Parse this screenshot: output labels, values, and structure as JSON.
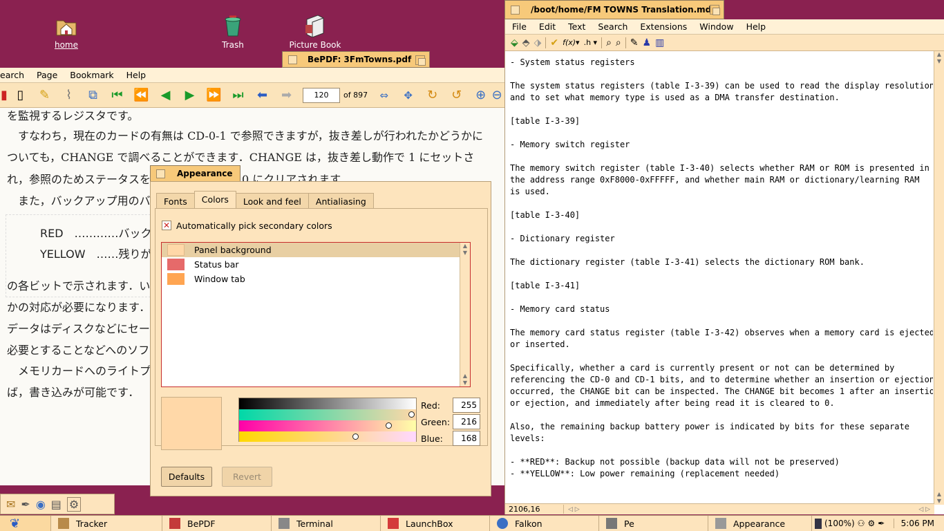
{
  "desktop": {
    "icons": [
      {
        "label": "home"
      },
      {
        "label": "Trash"
      },
      {
        "label": "Picture Book"
      }
    ]
  },
  "bepdf": {
    "title": "BePDF: 3FmTowns.pdf",
    "menu": [
      "earch",
      "Page",
      "Bookmark",
      "Help"
    ],
    "page_value": "120",
    "page_total": "of 897",
    "lines": [
      "を監視するレジスタです。",
      "　すなわち，現在のカードの有無は CD-0-1 で参照できますが，抜き差しが行われたかどうかに",
      "ついても，CHANGE で調べることができます．CHANGE は，抜き差し動作で 1 にセットさ",
      "れ，参照のためステータスを",
      "　また，バックアップ用のバ",
      "RED　…………バック",
      "YELLOW　……残りが",
      "の各ビットで示されます．い",
      "かの対応が必要になります．",
      "データはディスクなどにセー",
      "必要とすることなどへのソフ",
      "　メモリカードへのライトプ",
      "ば，書き込みが可能です．"
    ],
    "behind_text": "0 にクリアされます．"
  },
  "appearance": {
    "title": "Appearance",
    "tabs": [
      "Fonts",
      "Colors",
      "Look and feel",
      "Antialiasing"
    ],
    "auto_label": "Automatically pick secondary colors",
    "items": [
      {
        "label": "Panel background",
        "color": "#ffd8a8"
      },
      {
        "label": "Status bar",
        "color": "#e66a6a"
      },
      {
        "label": "Window tab",
        "color": "#ffa552"
      }
    ],
    "red_label": "Red:",
    "green_label": "Green:",
    "blue_label": "Blue:",
    "red": "255",
    "green": "216",
    "blue": "168",
    "red_level": 1.0,
    "green_level": 0.847,
    "blue_level": 0.659,
    "defaults": "Defaults",
    "revert": "Revert"
  },
  "editor": {
    "title": "/boot/home/FM TOWNS Translation.md",
    "menu": [
      "File",
      "Edit",
      "Text",
      "Search",
      "Extensions",
      "Window",
      "Help"
    ],
    "content": "- System status registers\n\nThe system status registers (table I-3-39) can be used to read the display resolution\nand to set what memory type is used as a DMA transfer destination.\n\n[table I-3-39]\n\n- Memory switch register\n\nThe memory switch register (table I-3-40) selects whether RAM or ROM is presented in\nthe address range 0xF8000-0xFFFFF, and whether main RAM or dictionary/learning RAM\nis used.\n\n[table I-3-40]\n\n- Dictionary register\n\nThe dictionary register (table I-3-41) selects the dictionary ROM bank.\n\n[table I-3-41]\n\n- Memory card status\n\nThe memory card status register (table I-3-42) observes when a memory card is ejected\nor inserted.\n\nSpecifically, whether a card is currently present or not can be determined by\nreferencing the CD-0 and CD-1 bits, and to determine whether an insertion or ejection\noccurred, the CHANGE bit can be inspected. The CHANGE bit becomes 1 after an insertion\nor ejection, and immediately after being read it is cleared to 0.\n\nAlso, the remaining backup battery power is indicated by bits for these separate\nlevels:\n\n- **RED**: Backup not possible (backup data will not be preserved)\n- **YELLOW**: Low power remaining (replacement needed)",
    "position": "2106,16"
  },
  "taskbar": {
    "items": [
      "Tracker",
      "BePDF",
      "Terminal",
      "LaunchBox",
      "Falkon",
      "Pe",
      "Appearance"
    ],
    "battery": "(100%)",
    "clock": "5:06 PM"
  }
}
